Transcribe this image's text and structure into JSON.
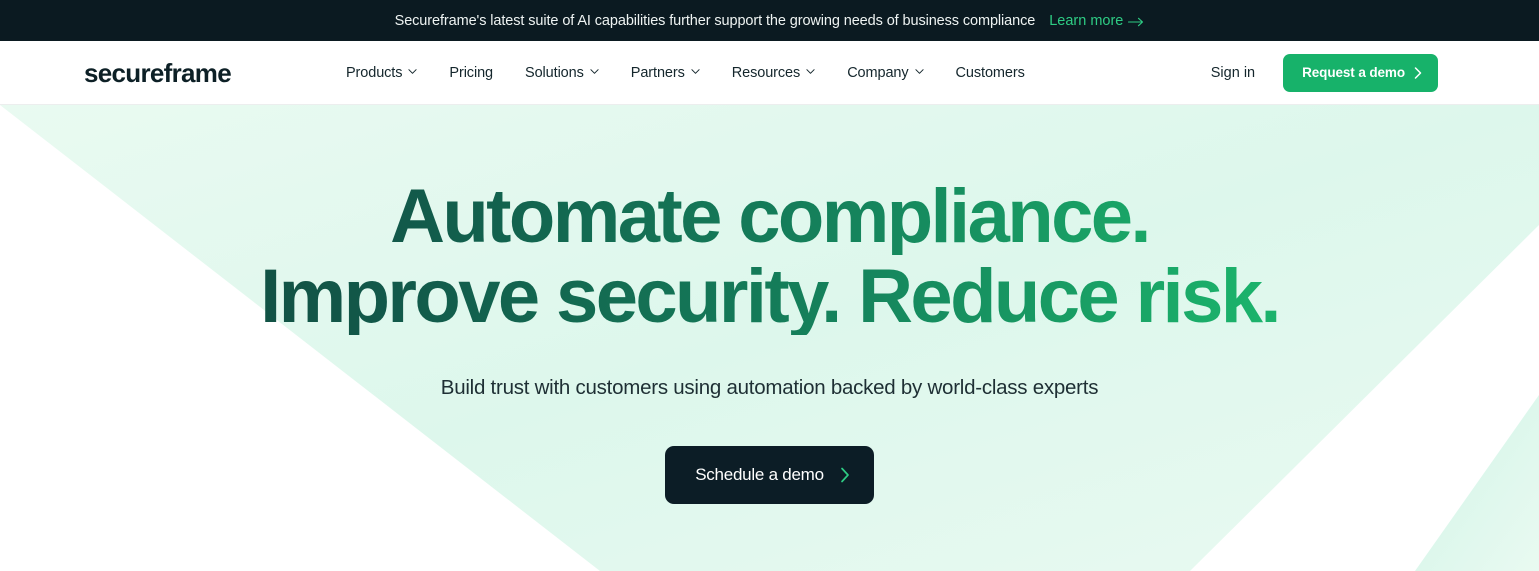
{
  "announcement": {
    "text": "Secureframe's latest suite of AI capabilities further support the growing needs of business compliance",
    "link_label": "Learn more",
    "link_icon": "arrow-right-icon",
    "background_color": "#0b1a21",
    "link_color": "#2ecc84"
  },
  "header": {
    "logo": "secureframe",
    "nav": [
      {
        "label": "Products",
        "has_dropdown": true,
        "icon": "chevron-down-icon"
      },
      {
        "label": "Pricing",
        "has_dropdown": false,
        "icon": ""
      },
      {
        "label": "Solutions",
        "has_dropdown": true,
        "icon": "chevron-down-icon"
      },
      {
        "label": "Partners",
        "has_dropdown": true,
        "icon": "chevron-down-icon"
      },
      {
        "label": "Resources",
        "has_dropdown": true,
        "icon": "chevron-down-icon"
      },
      {
        "label": "Company",
        "has_dropdown": true,
        "icon": "chevron-down-icon"
      },
      {
        "label": "Customers",
        "has_dropdown": false,
        "icon": ""
      }
    ],
    "sign_in_label": "Sign in",
    "demo_button_label": "Request a demo",
    "demo_button_icon": "chevron-right-icon",
    "demo_button_color": "#17b26a"
  },
  "hero": {
    "headline_line1": "Automate compliance.",
    "headline_line2": "Improve security. Reduce risk.",
    "headline_gradient_from": "#10463b",
    "headline_gradient_to": "#21c47a",
    "subheadline": "Build trust with customers using automation backed by world-class experts",
    "cta_label": "Schedule a demo",
    "cta_icon": "chevron-right-icon",
    "cta_background": "#0c1d26",
    "cta_icon_color": "#2ecc84",
    "background_band_color": "#e3f8ee",
    "background_base_color": "#ffffff"
  }
}
